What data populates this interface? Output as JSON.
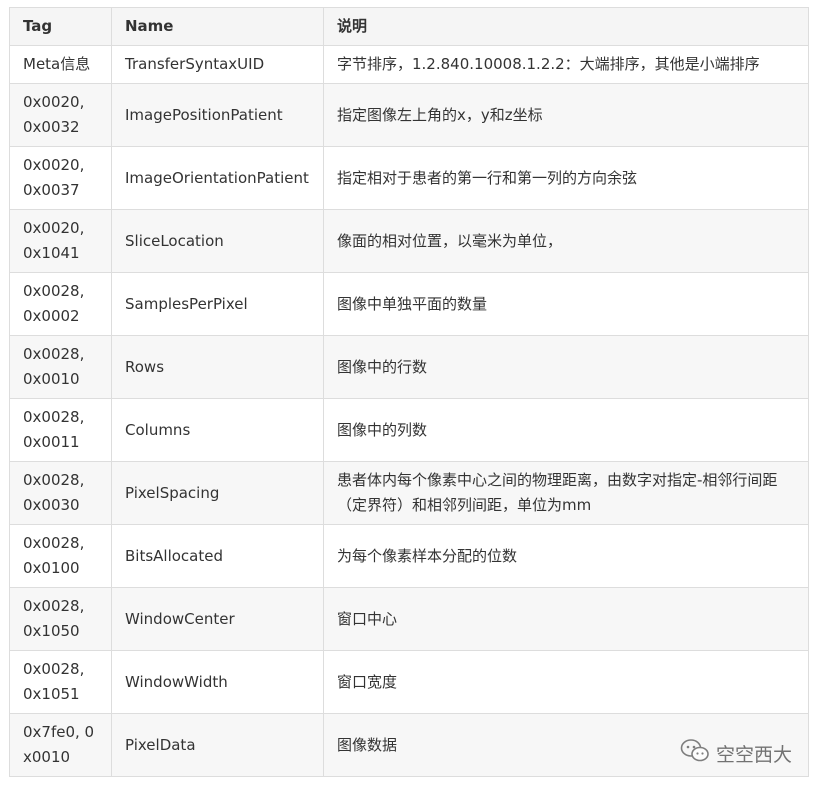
{
  "table": {
    "headers": {
      "tag": "Tag",
      "name": "Name",
      "desc": "说明"
    },
    "rows": [
      {
        "tag": "Meta信息",
        "name": "TransferSyntaxUID",
        "desc": "字节排序，1.2.840.10008.1.2.2：大端排序，其他是小端排序"
      },
      {
        "tag": "0x0020, 0x0032",
        "name": "ImagePositionPatient",
        "desc": "指定图像左上角的x，y和z坐标"
      },
      {
        "tag": "0x0020, 0x0037",
        "name": "ImageOrientationPatient",
        "desc": "指定相对于患者的第一行和第一列的方向余弦"
      },
      {
        "tag": "0x0020, 0x1041",
        "name": "SliceLocation",
        "desc": "像面的相对位置，以毫米为单位，"
      },
      {
        "tag": "0x0028, 0x0002",
        "name": "SamplesPerPixel",
        "desc": "图像中单独平面的数量"
      },
      {
        "tag": "0x0028, 0x0010",
        "name": "Rows",
        "desc": "图像中的行数"
      },
      {
        "tag": "0x0028, 0x0011",
        "name": "Columns",
        "desc": "图像中的列数"
      },
      {
        "tag": "0x0028, 0x0030",
        "name": "PixelSpacing",
        "desc": "患者体内每个像素中心之间的物理距离，由数字对指定-相邻行间距（定界符）和相邻列间距，单位为mm"
      },
      {
        "tag": "0x0028, 0x0100",
        "name": "BitsAllocated",
        "desc": "为每个像素样本分配的位数"
      },
      {
        "tag": "0x0028, 0x1050",
        "name": "WindowCenter",
        "desc": "窗口中心"
      },
      {
        "tag": "0x0028, 0x1051",
        "name": "WindowWidth",
        "desc": "窗口宽度"
      },
      {
        "tag": "0x7fe0, 0x0010",
        "name": "PixelData",
        "desc": "图像数据"
      }
    ]
  },
  "watermark": {
    "text": "空空西大",
    "icon": "wechat-icon"
  },
  "colors": {
    "border": "#dddddd",
    "header_bg": "#f5f5f5",
    "stripe_bg": "#f7f7f7",
    "text": "#333333"
  }
}
